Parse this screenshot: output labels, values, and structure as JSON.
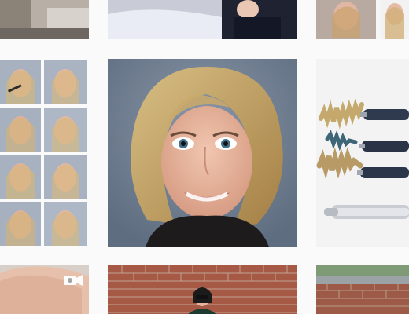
{
  "grid": {
    "tiles": [
      {
        "name": "post-top-left",
        "icon": "photo"
      },
      {
        "name": "post-top-center",
        "icon": "photo"
      },
      {
        "name": "post-top-right",
        "icon": "photo"
      },
      {
        "name": "post-middle-left-collage",
        "icon": "photo"
      },
      {
        "name": "post-middle-center-portrait",
        "icon": "photo"
      },
      {
        "name": "post-middle-right-eyeliners",
        "icon": "photo"
      },
      {
        "name": "post-bottom-left-video",
        "icon": "video-camera-icon"
      },
      {
        "name": "post-bottom-center-brickwall",
        "icon": "photo"
      },
      {
        "name": "post-bottom-right-brickwall",
        "icon": "photo"
      }
    ]
  },
  "colors": {
    "background": "#fafafa",
    "portrait_background": "#6f7f93",
    "brick": "#a65a45",
    "eyeliner_tube": "#2f3a4f",
    "gold_swatch": "#c5a86b"
  }
}
